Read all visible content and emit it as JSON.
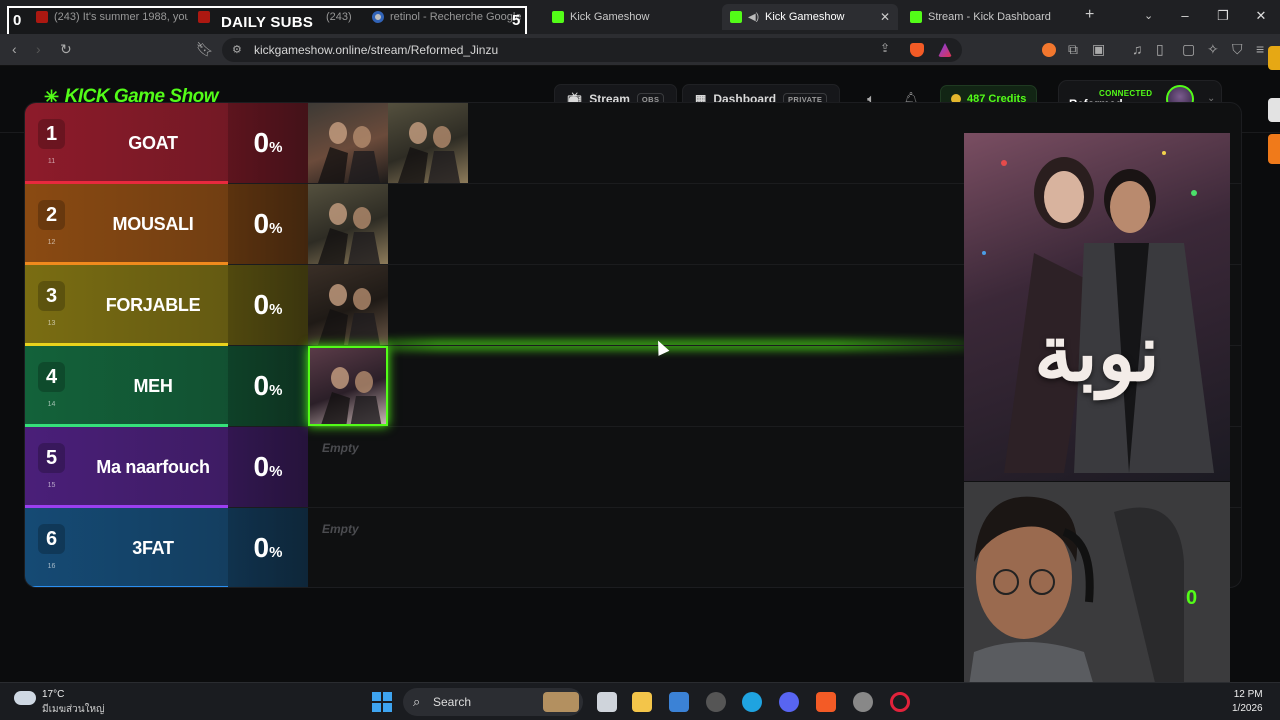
{
  "overlay": {
    "left_number": "0",
    "title": "DAILY SUBS",
    "right_number": "5"
  },
  "browser": {
    "tabs": [
      {
        "label": "(243) It's summer 1988, you",
        "icon": "youtube-icon",
        "active": false
      },
      {
        "label": "(243)",
        "icon": "youtube-icon",
        "active": false
      },
      {
        "label": "retinol - Recherche Google",
        "icon": "google-icon",
        "active": false
      },
      {
        "label": "Kick Gameshow",
        "icon": "kick-icon",
        "active": false
      },
      {
        "label": "Kick Gameshow",
        "icon": "kick-icon",
        "active": true
      },
      {
        "label": "Stream - Kick Dashboard",
        "icon": "kick-icon",
        "active": false
      }
    ],
    "url": "kickgameshow.online/stream/Reformed_Jinzu"
  },
  "header": {
    "logo": "KICK Game Show",
    "stream_label": "Stream",
    "stream_pill": "OBS",
    "dashboard_label": "Dashboard",
    "dashboard_pill": "PRIVATE",
    "credits": "487 Credits",
    "connected": "CONNECTED",
    "username": "Reformed_..."
  },
  "tiers": [
    {
      "rank": "1",
      "sub": "11",
      "name": "GOAT",
      "percent": "0",
      "unit": "%",
      "color": "#8d1b2a",
      "accent": "#e8293e",
      "items": 2,
      "empty": ""
    },
    {
      "rank": "2",
      "sub": "12",
      "name": "MOUSALI",
      "percent": "0",
      "unit": "%",
      "color": "#8a4a12",
      "accent": "#f08a1d",
      "items": 1,
      "empty": ""
    },
    {
      "rank": "3",
      "sub": "13",
      "name": "FORJABLE",
      "percent": "0",
      "unit": "%",
      "color": "#7a6d12",
      "accent": "#e9d21c",
      "items": 1,
      "empty": ""
    },
    {
      "rank": "4",
      "sub": "14",
      "name": "MEH",
      "percent": "0",
      "unit": "%",
      "color": "#13623a",
      "accent": "#36e07a",
      "items": 1,
      "empty": ""
    },
    {
      "rank": "5",
      "sub": "15",
      "name": "Ma naarfouch",
      "percent": "0",
      "unit": "%",
      "color": "#4a1f79",
      "accent": "#9b3ff0",
      "items": 0,
      "empty": "Empty"
    },
    {
      "rank": "6",
      "sub": "16",
      "name": "3FAT",
      "percent": "0",
      "unit": "%",
      "color": "#154a74",
      "accent": "#2b8ff0",
      "items": 0,
      "empty": "Empty"
    }
  ],
  "poster": {
    "title": "نوبة"
  },
  "webcam": {
    "counter": "0"
  },
  "taskbar": {
    "temp": "17°C",
    "weather": "มีเมฆส่วนใหญ่",
    "search": "Search",
    "time": "12 PM",
    "date": "1/2026"
  }
}
